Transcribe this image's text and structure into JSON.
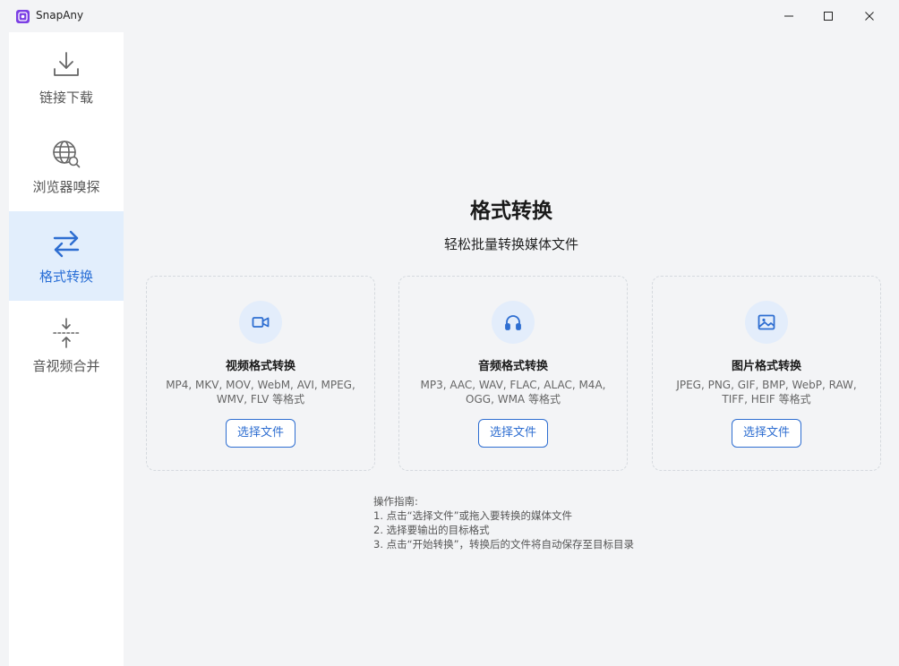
{
  "app": {
    "title": "SnapAny",
    "accent_color": "#2e6ed1",
    "logo_color": "#7b3fe4"
  },
  "window_controls": {
    "minimize_icon": "minimize-icon",
    "maximize_icon": "maximize-icon",
    "close_icon": "close-icon"
  },
  "sidebar": {
    "items": [
      {
        "label": "链接下载",
        "icon": "download-icon",
        "active": false
      },
      {
        "label": "浏览器嗅探",
        "icon": "globe-search-icon",
        "active": false
      },
      {
        "label": "格式转换",
        "icon": "swap-arrows-icon",
        "active": true
      },
      {
        "label": "音视频合并",
        "icon": "merge-icon",
        "active": false
      }
    ]
  },
  "main": {
    "title": "格式转换",
    "subtitle": "轻松批量转换媒体文件",
    "cards": [
      {
        "title": "视频格式转换",
        "formats_line1": "MP4, MKV, MOV, WebM, AVI, MPEG,",
        "formats_line2": "WMV, FLV 等格式",
        "button": "选择文件",
        "icon": "video-icon"
      },
      {
        "title": "音频格式转换",
        "formats_line1": "MP3, AAC, WAV, FLAC, ALAC, M4A,",
        "formats_line2": "OGG, WMA 等格式",
        "button": "选择文件",
        "icon": "headphones-icon"
      },
      {
        "title": "图片格式转换",
        "formats_line1": "JPEG, PNG, GIF, BMP, WebP, RAW,",
        "formats_line2": "TIFF, HEIF 等格式",
        "button": "选择文件",
        "icon": "image-icon"
      }
    ],
    "guide": {
      "heading": "操作指南:",
      "steps": [
        "1. 点击“选择文件”或拖入要转换的媒体文件",
        "2. 选择要输出的目标格式",
        "3. 点击“开始转换”，转换后的文件将自动保存至目标目录"
      ]
    }
  }
}
